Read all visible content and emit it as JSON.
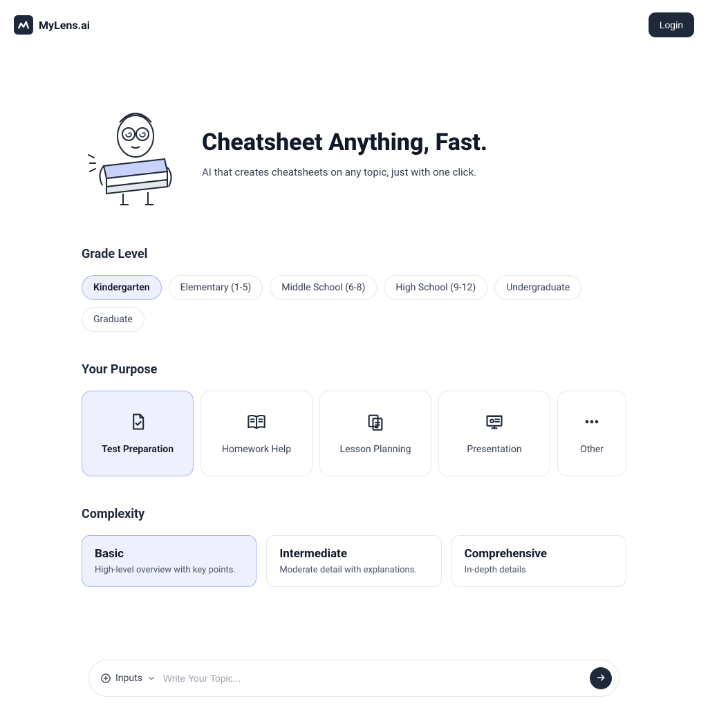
{
  "brand": {
    "name": "MyLens.ai"
  },
  "header": {
    "login_label": "Login"
  },
  "hero": {
    "title": "Cheatsheet Anything, Fast.",
    "subtitle": "AI that creates cheatsheets on any topic, just with one click."
  },
  "grade": {
    "title": "Grade Level",
    "options": [
      "Kindergarten",
      "Elementary (1-5)",
      "Middle School (6-8)",
      "High School (9-12)",
      "Undergraduate",
      "Graduate"
    ],
    "selected_index": 0
  },
  "purpose": {
    "title": "Your Purpose",
    "options": [
      {
        "label": "Test Preparation",
        "icon": "document-check-icon"
      },
      {
        "label": "Homework Help",
        "icon": "book-open-icon"
      },
      {
        "label": "Lesson Planning",
        "icon": "clipboard-icon"
      },
      {
        "label": "Presentation",
        "icon": "presentation-icon"
      },
      {
        "label": "Other",
        "icon": "dots-icon"
      }
    ],
    "selected_index": 0
  },
  "complexity": {
    "title": "Complexity",
    "options": [
      {
        "title": "Basic",
        "desc": "High-level overview with key points."
      },
      {
        "title": "Intermediate",
        "desc": "Moderate detail with explanations."
      },
      {
        "title": "Comprehensive",
        "desc": "In-depth details"
      }
    ],
    "selected_index": 0
  },
  "input_bar": {
    "inputs_label": "Inputs",
    "placeholder": "Write Your Topic..."
  }
}
